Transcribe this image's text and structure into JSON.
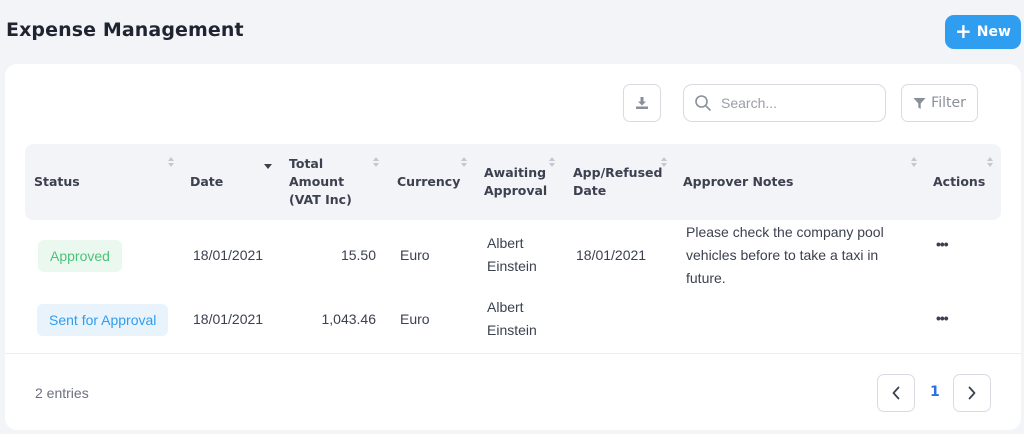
{
  "header": {
    "title": "Expense Management",
    "new_label": "New"
  },
  "toolbar": {
    "search_placeholder": "Search...",
    "filter_label": "Filter"
  },
  "table": {
    "columns": {
      "status": "Status",
      "date": "Date",
      "total_amount": [
        "Total",
        "Amount",
        "(VAT Inc)"
      ],
      "currency": "Currency",
      "awaiting": [
        "Awaiting",
        "Approval"
      ],
      "app_refused": [
        "App/Refused",
        "Date"
      ],
      "notes": "Approver Notes",
      "actions": "Actions"
    },
    "rows": [
      {
        "status": "Approved",
        "date": "18/01/2021",
        "amount": "15.50",
        "currency": "Euro",
        "awaiting": [
          "Albert",
          "Einstein"
        ],
        "app_refused_date": "18/01/2021",
        "notes": [
          "Please check the company pool",
          "vehicles before to take a taxi in",
          "future."
        ]
      },
      {
        "status": "Sent for Approval",
        "date": "18/01/2021",
        "amount": "1,043.46",
        "currency": "Euro",
        "awaiting": [
          "Albert",
          "Einstein"
        ],
        "app_refused_date": "",
        "notes": []
      }
    ]
  },
  "footer": {
    "entries": "2 entries",
    "current_page": "1"
  },
  "colors": {
    "accent": "#2f9df0",
    "approved_text": "#4cc27a",
    "approved_bg": "#ebf8ef",
    "sent_text": "#2f9df0",
    "sent_bg": "#e8f3fc"
  }
}
